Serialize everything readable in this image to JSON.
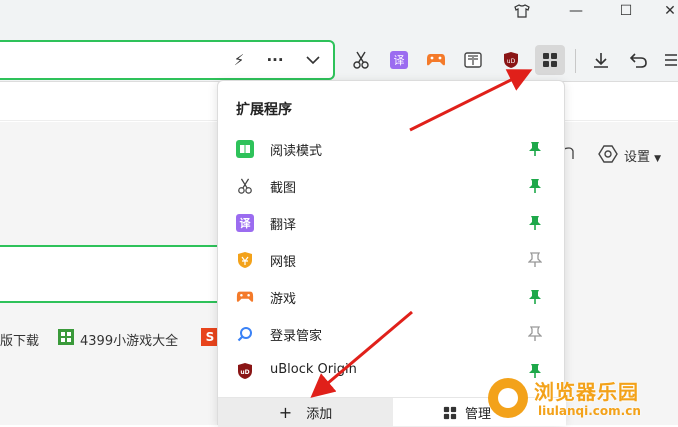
{
  "window": {
    "shirt_icon": "shirt-icon",
    "minimize": "—",
    "maximize": "☐",
    "close": "✕"
  },
  "toolbar": {
    "lightning": "⚡",
    "more": "···",
    "chevron": "⌄",
    "ext_translate": "译",
    "ext_ublock": "uD",
    "download": "⤓",
    "undo": "↶",
    "menu": "☰"
  },
  "page": {
    "settings_label": "设置",
    "link1": "版下载",
    "link2": "4399小游戏大全",
    "link3_badge": "S"
  },
  "popup": {
    "title": "扩展程序",
    "items": [
      {
        "label": "阅读模式",
        "icon": "book-icon",
        "color": "#2ec25a",
        "pinned": true
      },
      {
        "label": "截图",
        "icon": "scissors-icon",
        "color": "#555555",
        "pinned": true
      },
      {
        "label": "翻译",
        "icon": "translate-icon",
        "color": "#9b6cf0",
        "pinned": true
      },
      {
        "label": "网银",
        "icon": "shield-icon",
        "color": "#f3a21a",
        "pinned": false
      },
      {
        "label": "游戏",
        "icon": "gamepad-icon",
        "color": "#f47a2a",
        "pinned": true
      },
      {
        "label": "登录管家",
        "icon": "key-search-icon",
        "color": "#3b82f6",
        "pinned": false
      },
      {
        "label": "uBlock Origin",
        "icon": "ublock-icon",
        "color": "#8a1515",
        "pinned": true
      }
    ],
    "footer": {
      "add_symbol": "+",
      "add_label": "添加",
      "manage_label": "管理"
    }
  },
  "watermark": {
    "title": "浏览器乐园",
    "url": "liulanqi.com.cn"
  },
  "colors": {
    "accent_green": "#2ec25a",
    "arrow_red": "#e0201a",
    "pin_green": "#1ea84a",
    "pin_gray": "#999999",
    "watermark_orange": "#f3a21a"
  }
}
